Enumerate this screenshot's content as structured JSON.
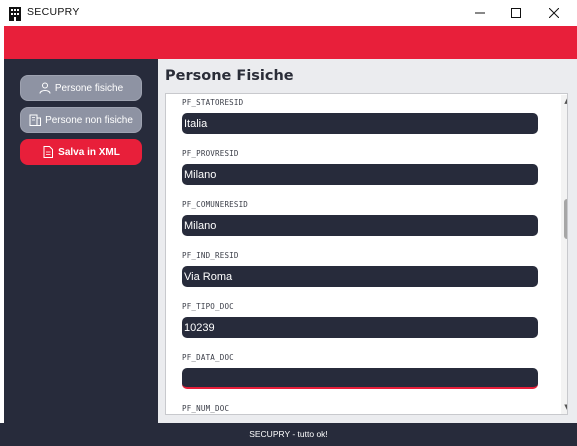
{
  "window": {
    "title": "SECUPRY"
  },
  "sidebar": {
    "buttons": [
      {
        "label": "Persone fisiche",
        "icon": "person-icon"
      },
      {
        "label": "Persone non fisiche",
        "icon": "building-icon"
      },
      {
        "label": "Salva in XML",
        "icon": "document-icon"
      }
    ]
  },
  "main": {
    "title": "Persone Fisiche",
    "fields": [
      {
        "label": "PF_STATORESID",
        "value": "Italia"
      },
      {
        "label": "PF_PROVRESID",
        "value": "Milano"
      },
      {
        "label": "PF_COMUNERESID",
        "value": "Milano"
      },
      {
        "label": "PF_IND_RESID",
        "value": "Via Roma"
      },
      {
        "label": "PF_TIPO_DOC",
        "value": "10239"
      },
      {
        "label": "PF_DATA_DOC",
        "value": ""
      },
      {
        "label": "PF_NUM_DOC",
        "value": ""
      }
    ]
  },
  "status": {
    "text": "SECUPRY - tutto ok!"
  },
  "colors": {
    "accent": "#e81f3a",
    "dark": "#272b3b",
    "gray_button": "#8e93a3"
  }
}
